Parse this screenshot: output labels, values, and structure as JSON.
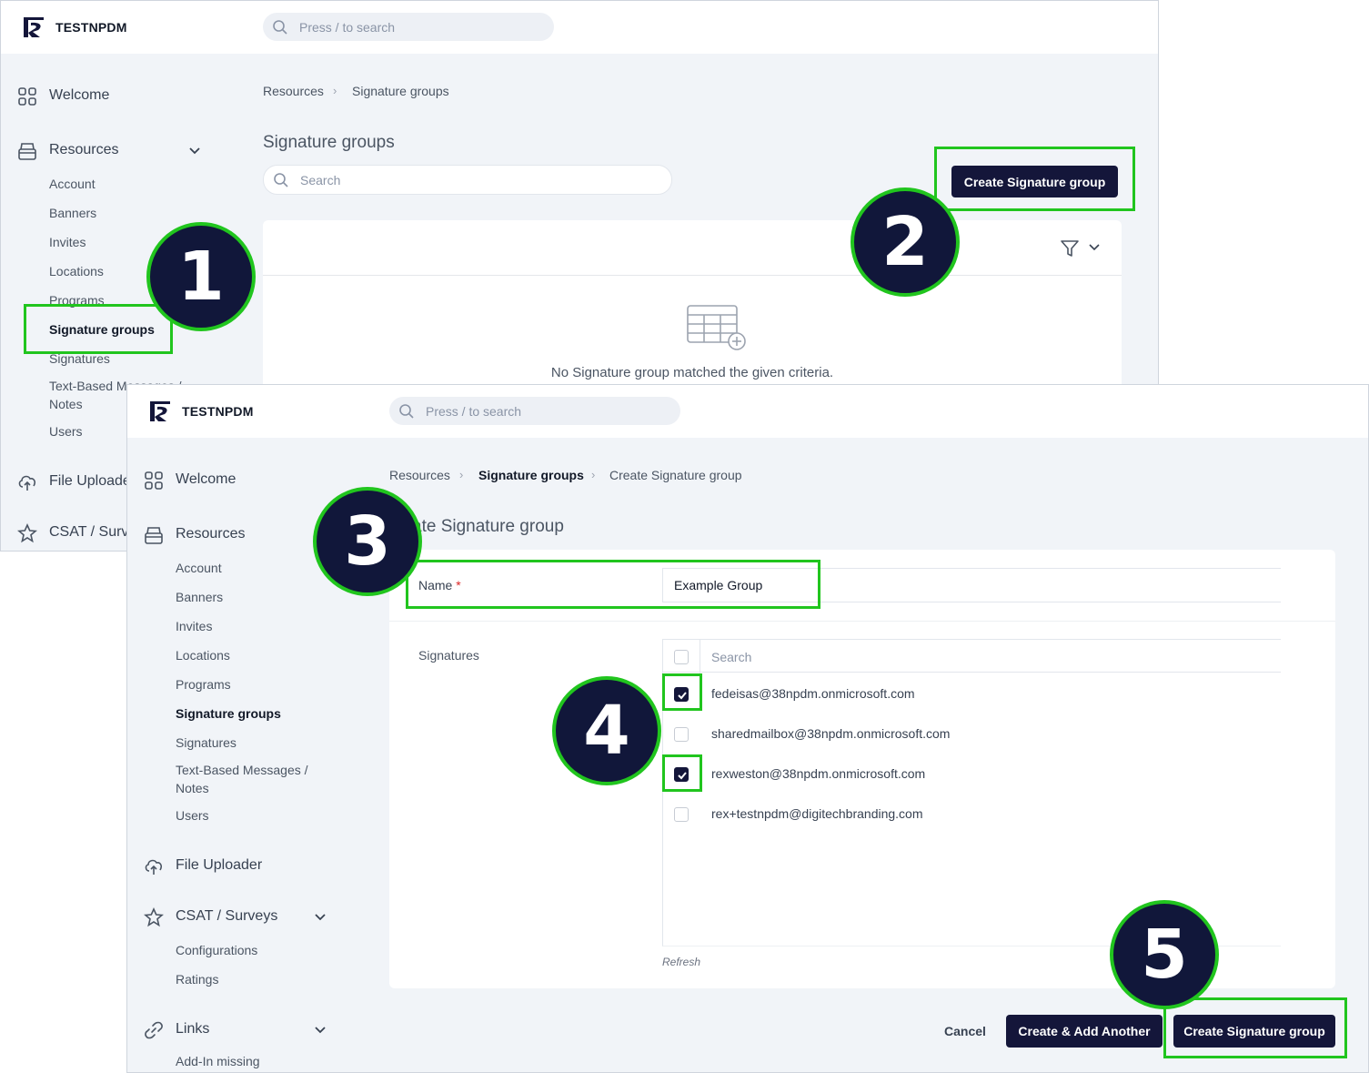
{
  "brand": "TESTNPDM",
  "top_search_placeholder": "Press / to search",
  "colors": {
    "accent_dark": "#14163a",
    "highlight_green": "#21c51e",
    "background": "#f1f4f8"
  },
  "window1": {
    "nav": {
      "welcome": "Welcome",
      "resources": "Resources",
      "resources_items": [
        "Account",
        "Banners",
        "Invites",
        "Locations",
        "Programs",
        "Signature groups",
        "Signatures",
        "Text-Based Messages /",
        "Notes",
        "Users"
      ],
      "file_uploader": "File Uploade",
      "csat": "CSAT / Surv"
    },
    "breadcrumb": [
      "Resources",
      "Signature groups"
    ],
    "title": "Signature groups",
    "search_placeholder": "Search",
    "create_button": "Create Signature group",
    "empty_text": "No Signature group matched the given criteria."
  },
  "window2": {
    "nav": {
      "welcome": "Welcome",
      "resources": "Resources",
      "resources_items": [
        "Account",
        "Banners",
        "Invites",
        "Locations",
        "Programs",
        "Signature groups",
        "Signatures"
      ],
      "text_based_1": "Text-Based Messages /",
      "text_based_2": "Notes",
      "users": "Users",
      "file_uploader": "File Uploader",
      "csat": "CSAT / Surveys",
      "csat_items": [
        "Configurations",
        "Ratings"
      ],
      "links": "Links",
      "links_items": [
        "Add-In missing"
      ]
    },
    "breadcrumb": [
      "Resources",
      "Signature groups",
      "Create Signature group"
    ],
    "title": "ate Signature group",
    "form": {
      "name_label": "Name",
      "required_mark": "*",
      "name_value": "Example Group",
      "signatures_label": "Signatures",
      "signatures_search_placeholder": "Search",
      "signatures": [
        {
          "email": "fedeisas@38npdm.onmicrosoft.com",
          "checked": true
        },
        {
          "email": "sharedmailbox@38npdm.onmicrosoft.com",
          "checked": false
        },
        {
          "email": "rexweston@38npdm.onmicrosoft.com",
          "checked": true
        },
        {
          "email": "rex+testnpdm@digitechbranding.com",
          "checked": false
        }
      ],
      "refresh": "Refresh"
    },
    "actions": {
      "cancel": "Cancel",
      "create_another": "Create & Add Another",
      "create": "Create Signature group"
    }
  },
  "steps": [
    "1",
    "2",
    "3",
    "4",
    "5"
  ]
}
